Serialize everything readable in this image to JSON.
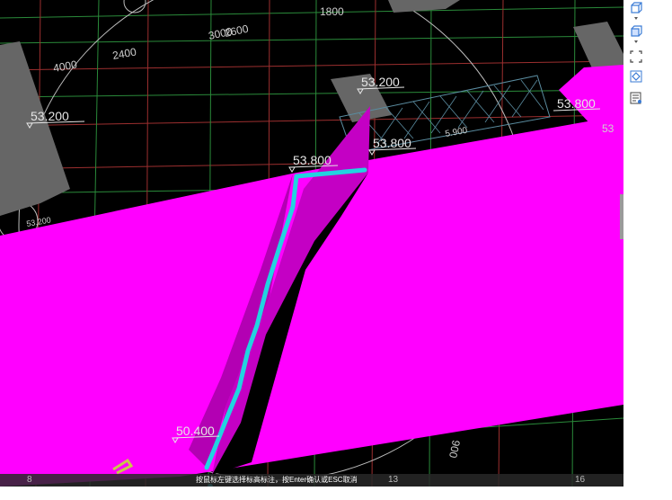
{
  "viewport": {
    "dimensions": {
      "d1": "1800",
      "d2": "3000",
      "d3": "2600",
      "d4": "2400",
      "d5": "4000",
      "d6": "006",
      "d7": "5.900",
      "d8": "53.200",
      "d9": "53.800",
      "d10": "53.200",
      "d11": "53.800",
      "d12": "53.800",
      "d13": "50.400",
      "d14": "53",
      "d15": "53.200"
    },
    "colors": {
      "background": "#000000",
      "slab": "#ff00ff",
      "ramp": "#c000c0",
      "polyline": "#22d3e0",
      "column": "#666666",
      "grid_red": "#b03030",
      "grid_green": "#1f9a3a"
    }
  },
  "status": {
    "message": "按鼠标左键选择标高标注，按Enter确认或ESC取消",
    "grid_numbers": [
      "8",
      "13",
      "16"
    ]
  },
  "toolbar": {
    "items": [
      {
        "icon": "view-cube-icon"
      },
      {
        "icon": "dropdown-arrow-icon"
      },
      {
        "icon": "3d-box-icon"
      },
      {
        "icon": "dropdown-arrow-icon"
      },
      {
        "icon": "select-region-icon"
      },
      {
        "icon": "layer-icon"
      },
      {
        "icon": "properties-list-icon"
      }
    ]
  }
}
